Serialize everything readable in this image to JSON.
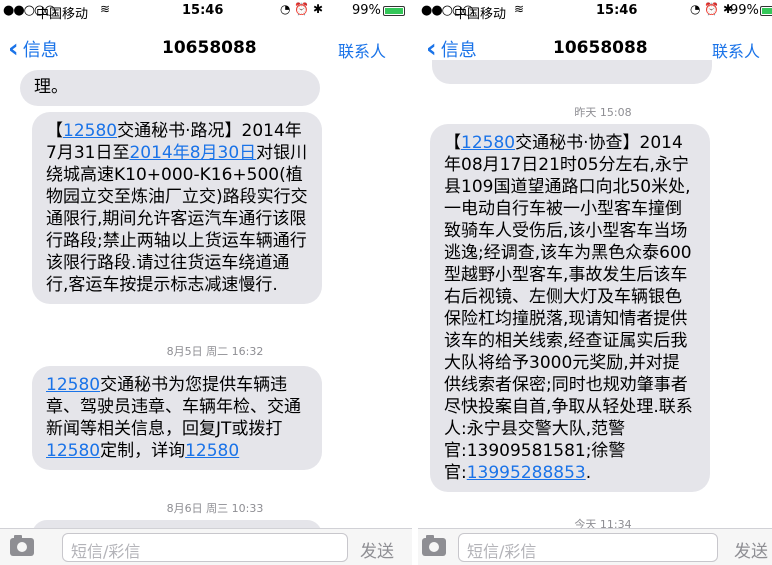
{
  "left": {
    "status": {
      "carrier": "中国移动",
      "time": "15:46",
      "battery": "99%",
      "signal": "●●○○○"
    },
    "nav": {
      "back": "信息",
      "title": "10658088",
      "contact": "联系人"
    },
    "messages": [
      {
        "text": "理。"
      },
      {
        "parts": [
          "【",
          "12580",
          "交通秘书·路况】2014年7月31日至",
          "2014年8月30日",
          "对银川绕城高速K10+000-K16+500(植物园立交至炼油厂立交)路段实行交通限行,期间允许客运汽车通行该限行路段;禁止两轴以上货运车辆通行该限行路段.请过往货运车绕道通行,客运车按提示标志减速慢行."
        ]
      },
      {
        "parts": [
          "12580",
          "交通秘书为您提供车辆违章、驾驶员违章、车辆年检、交通新闻等相关信息，回复JT或拨打",
          "12580",
          "定制，详询",
          "12580"
        ]
      }
    ],
    "timestamps": [
      "8月5日 周二 16:32",
      "8月6日 周三 10:33"
    ],
    "input": {
      "placeholder": "短信/彩信",
      "send": "发送"
    }
  },
  "right": {
    "status": {
      "carrier": "中国移动",
      "time": "15:46",
      "battery": "99%",
      "signal": "●●○○○"
    },
    "nav": {
      "back": "信息",
      "title": "10658088",
      "contact": "联系人"
    },
    "timestamps": [
      "昨天 15:08",
      "今天 11:34"
    ],
    "message": {
      "parts": [
        "【",
        "12580",
        "交通秘书·协查】2014年08月17日21时05分左右,永宁县109国道望通路口向北50米处,一电动自行车被一小型客车撞倒致骑车人受伤后,该小型客车当场逃逸;经调查,该车为黑色众泰600型越野小型客车,事故发生后该车右后视镜、左侧大灯及车辆银色保险杠均撞脱落,现请知情者提供该车的相关线索,经查证属实后我大队将给予3000元奖励,并对提供线索者保密;同时也规劝肇事者尽快投案自首,争取从轻处理.联系人:永宁县交警大队,范警官:13909581581;徐警官:",
        "13995288853",
        "."
      ]
    },
    "input": {
      "placeholder": "短信/彩信",
      "send": "发送"
    }
  },
  "colors": {
    "link": "#1a73e8",
    "bubble": "#e5e5ea",
    "timestamp": "#8e8e93"
  },
  "icons": {
    "back": "chevron-left-icon",
    "camera": "camera-icon",
    "wifi": "wifi-icon"
  }
}
